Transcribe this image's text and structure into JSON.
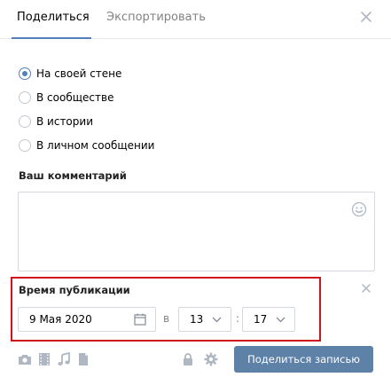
{
  "tabs": {
    "share_label": "Поделиться",
    "export_label": "Экспортировать"
  },
  "share_targets": [
    {
      "label": "На своей стене",
      "checked": true
    },
    {
      "label": "В сообществе",
      "checked": false
    },
    {
      "label": "В истории",
      "checked": false
    },
    {
      "label": "В личном сообщении",
      "checked": false
    }
  ],
  "comment": {
    "title": "Ваш комментарий",
    "value": ""
  },
  "publish_time": {
    "title": "Время публикации",
    "date": "9 Мая 2020",
    "at_label": "в",
    "hour": "13",
    "minute": "17"
  },
  "icons": {
    "close": "close-icon",
    "smiley": "smiley-icon",
    "calendar": "calendar-icon",
    "bottom": [
      "camera-icon",
      "video-icon",
      "music-icon",
      "document-icon",
      "lock-icon",
      "gear-icon"
    ]
  },
  "submit_label": "Поделиться записью",
  "colors": {
    "accent": "#5181b8",
    "button": "#5e81a8",
    "highlight_frame": "#d0121c",
    "icon_gray": "#aeb7c2"
  }
}
